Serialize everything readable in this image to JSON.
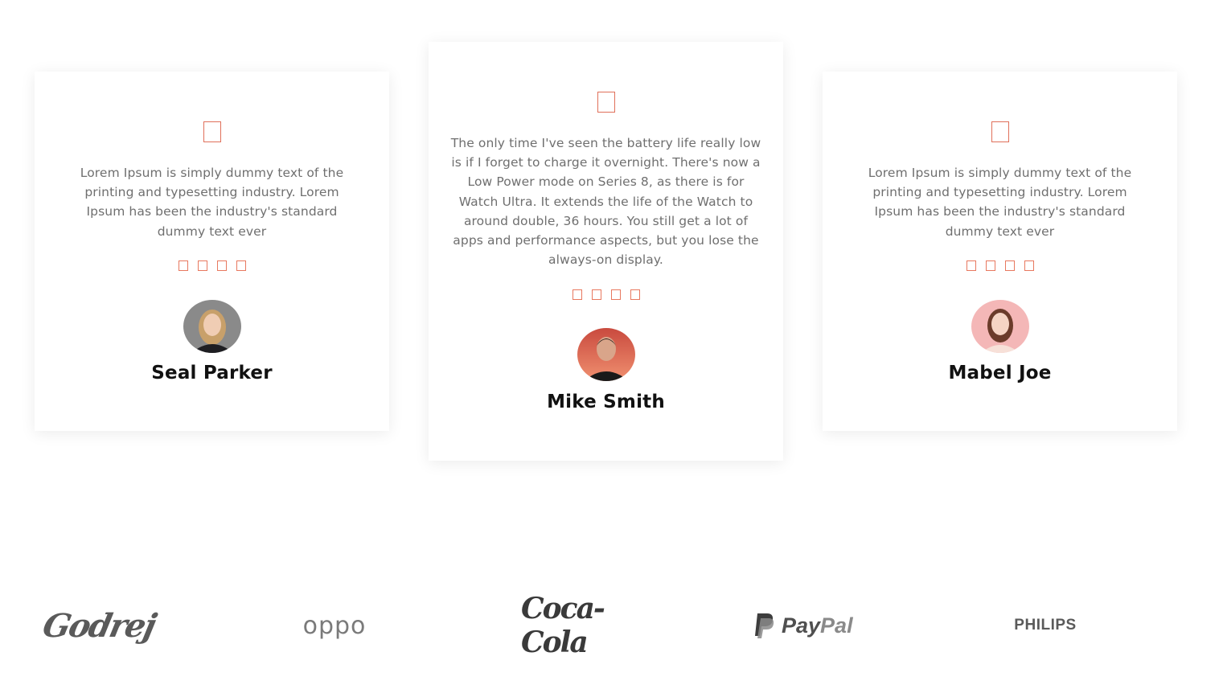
{
  "testimonials": [
    {
      "text": "Lorem Ipsum is simply dummy text of the printing and typesetting industry. Lorem Ipsum has been the industry's standard dummy text ever",
      "name": "Seal Parker",
      "stars": 4,
      "quote_icon": "quote-icon",
      "avatar_icon": "avatar"
    },
    {
      "text": "The only time I've seen the battery life really low is if I forget to charge it overnight. There's now a Low Power mode on Series 8, as there is for Watch Ultra. It extends the life of the Watch to around double, 36 hours. You still get a lot of apps and performance aspects, but you lose the always-on display.",
      "name": "Mike Smith",
      "stars": 4,
      "quote_icon": "quote-icon",
      "avatar_icon": "avatar"
    },
    {
      "text": "Lorem Ipsum is simply dummy text of the printing and typesetting industry. Lorem Ipsum has been the industry's standard dummy text ever",
      "name": "Mabel Joe",
      "stars": 4,
      "quote_icon": "quote-icon",
      "avatar_icon": "avatar"
    }
  ],
  "brands": {
    "godrej": "Godrej",
    "oppo": "oppo",
    "coca_cola": "Coca-Cola",
    "paypal_dark": "Pay",
    "paypal_light": "Pal",
    "philips": "PHILIPS"
  },
  "colors": {
    "accent": "#e0705a",
    "text": "#6f6f6f",
    "name": "#111111"
  }
}
